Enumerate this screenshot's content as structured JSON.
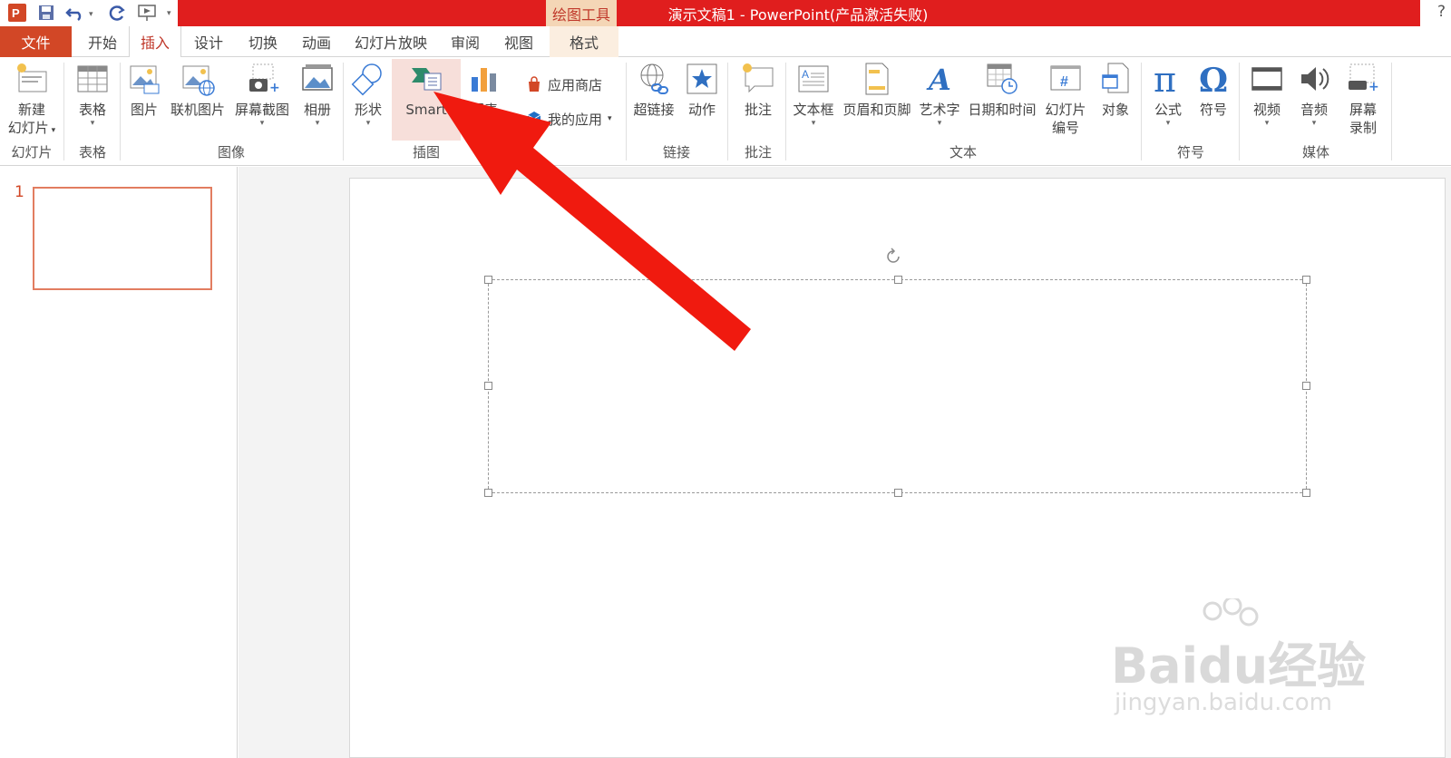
{
  "titlebar": {
    "context_tool": "绘图工具",
    "document_title": "演示文稿1 - PowerPoint(产品激活失败)",
    "help": "?",
    "accent_color": "#e01e1e"
  },
  "tabs": {
    "file": "文件",
    "home": "开始",
    "insert": "插入",
    "design": "设计",
    "transitions": "切换",
    "animations": "动画",
    "slideshow": "幻灯片放映",
    "review": "审阅",
    "view": "视图",
    "format": "格式"
  },
  "ribbon": {
    "new_slide_1": "新建",
    "new_slide_2": "幻灯片",
    "table": "表格",
    "picture": "图片",
    "online_picture": "联机图片",
    "screenshot": "屏幕截图",
    "album": "相册",
    "shapes": "形状",
    "smartart": "Smart",
    "chart": "图表",
    "app_store": "应用商店",
    "my_apps": "我的应用",
    "hyperlink": "超链接",
    "action": "动作",
    "comment": "批注",
    "textbox": "文本框",
    "header_footer": "页眉和页脚",
    "wordart": "艺术字",
    "datetime": "日期和时间",
    "slide_number_1": "幻灯片",
    "slide_number_2": "编号",
    "object": "对象",
    "equation": "公式",
    "symbol": "符号",
    "video": "视频",
    "audio": "音频",
    "screen_rec_1": "屏幕",
    "screen_rec_2": "录制",
    "groups": {
      "slides": "幻灯片",
      "tables": "表格",
      "images": "图像",
      "illustrations": "插图",
      "links": "链接",
      "comments": "批注",
      "text": "文本",
      "symbols": "符号",
      "media": "媒体"
    }
  },
  "thumbnails": {
    "slide_number": "1"
  },
  "watermark": {
    "brand": "Baidu经验",
    "url": "jingyan.baidu.com"
  }
}
